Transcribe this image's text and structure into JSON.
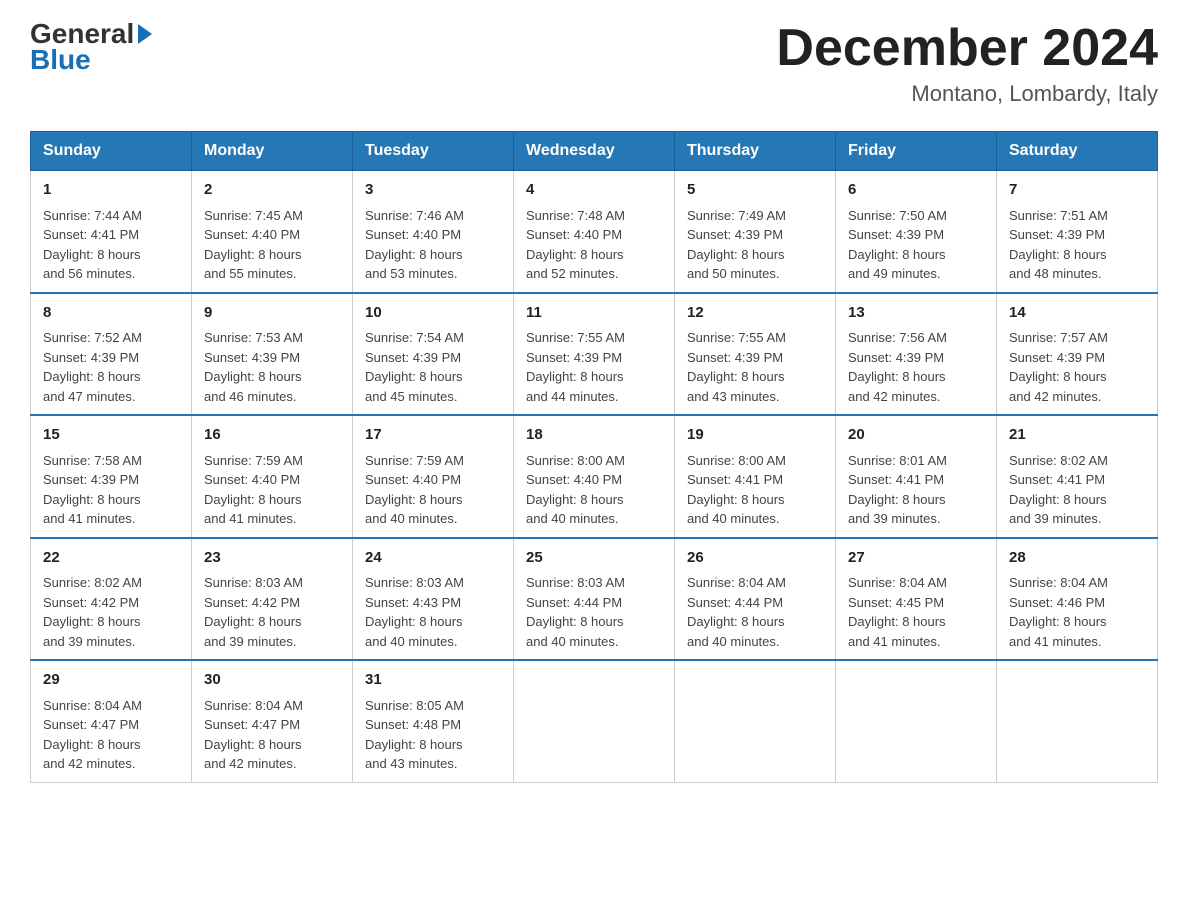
{
  "header": {
    "logo_general": "General",
    "logo_blue": "Blue",
    "month_title": "December 2024",
    "location": "Montano, Lombardy, Italy"
  },
  "weekdays": [
    "Sunday",
    "Monday",
    "Tuesday",
    "Wednesday",
    "Thursday",
    "Friday",
    "Saturday"
  ],
  "weeks": [
    [
      {
        "day": "1",
        "sunrise": "7:44 AM",
        "sunset": "4:41 PM",
        "daylight": "8 hours and 56 minutes."
      },
      {
        "day": "2",
        "sunrise": "7:45 AM",
        "sunset": "4:40 PM",
        "daylight": "8 hours and 55 minutes."
      },
      {
        "day": "3",
        "sunrise": "7:46 AM",
        "sunset": "4:40 PM",
        "daylight": "8 hours and 53 minutes."
      },
      {
        "day": "4",
        "sunrise": "7:48 AM",
        "sunset": "4:40 PM",
        "daylight": "8 hours and 52 minutes."
      },
      {
        "day": "5",
        "sunrise": "7:49 AM",
        "sunset": "4:39 PM",
        "daylight": "8 hours and 50 minutes."
      },
      {
        "day": "6",
        "sunrise": "7:50 AM",
        "sunset": "4:39 PM",
        "daylight": "8 hours and 49 minutes."
      },
      {
        "day": "7",
        "sunrise": "7:51 AM",
        "sunset": "4:39 PM",
        "daylight": "8 hours and 48 minutes."
      }
    ],
    [
      {
        "day": "8",
        "sunrise": "7:52 AM",
        "sunset": "4:39 PM",
        "daylight": "8 hours and 47 minutes."
      },
      {
        "day": "9",
        "sunrise": "7:53 AM",
        "sunset": "4:39 PM",
        "daylight": "8 hours and 46 minutes."
      },
      {
        "day": "10",
        "sunrise": "7:54 AM",
        "sunset": "4:39 PM",
        "daylight": "8 hours and 45 minutes."
      },
      {
        "day": "11",
        "sunrise": "7:55 AM",
        "sunset": "4:39 PM",
        "daylight": "8 hours and 44 minutes."
      },
      {
        "day": "12",
        "sunrise": "7:55 AM",
        "sunset": "4:39 PM",
        "daylight": "8 hours and 43 minutes."
      },
      {
        "day": "13",
        "sunrise": "7:56 AM",
        "sunset": "4:39 PM",
        "daylight": "8 hours and 42 minutes."
      },
      {
        "day": "14",
        "sunrise": "7:57 AM",
        "sunset": "4:39 PM",
        "daylight": "8 hours and 42 minutes."
      }
    ],
    [
      {
        "day": "15",
        "sunrise": "7:58 AM",
        "sunset": "4:39 PM",
        "daylight": "8 hours and 41 minutes."
      },
      {
        "day": "16",
        "sunrise": "7:59 AM",
        "sunset": "4:40 PM",
        "daylight": "8 hours and 41 minutes."
      },
      {
        "day": "17",
        "sunrise": "7:59 AM",
        "sunset": "4:40 PM",
        "daylight": "8 hours and 40 minutes."
      },
      {
        "day": "18",
        "sunrise": "8:00 AM",
        "sunset": "4:40 PM",
        "daylight": "8 hours and 40 minutes."
      },
      {
        "day": "19",
        "sunrise": "8:00 AM",
        "sunset": "4:41 PM",
        "daylight": "8 hours and 40 minutes."
      },
      {
        "day": "20",
        "sunrise": "8:01 AM",
        "sunset": "4:41 PM",
        "daylight": "8 hours and 39 minutes."
      },
      {
        "day": "21",
        "sunrise": "8:02 AM",
        "sunset": "4:41 PM",
        "daylight": "8 hours and 39 minutes."
      }
    ],
    [
      {
        "day": "22",
        "sunrise": "8:02 AM",
        "sunset": "4:42 PM",
        "daylight": "8 hours and 39 minutes."
      },
      {
        "day": "23",
        "sunrise": "8:03 AM",
        "sunset": "4:42 PM",
        "daylight": "8 hours and 39 minutes."
      },
      {
        "day": "24",
        "sunrise": "8:03 AM",
        "sunset": "4:43 PM",
        "daylight": "8 hours and 40 minutes."
      },
      {
        "day": "25",
        "sunrise": "8:03 AM",
        "sunset": "4:44 PM",
        "daylight": "8 hours and 40 minutes."
      },
      {
        "day": "26",
        "sunrise": "8:04 AM",
        "sunset": "4:44 PM",
        "daylight": "8 hours and 40 minutes."
      },
      {
        "day": "27",
        "sunrise": "8:04 AM",
        "sunset": "4:45 PM",
        "daylight": "8 hours and 41 minutes."
      },
      {
        "day": "28",
        "sunrise": "8:04 AM",
        "sunset": "4:46 PM",
        "daylight": "8 hours and 41 minutes."
      }
    ],
    [
      {
        "day": "29",
        "sunrise": "8:04 AM",
        "sunset": "4:47 PM",
        "daylight": "8 hours and 42 minutes."
      },
      {
        "day": "30",
        "sunrise": "8:04 AM",
        "sunset": "4:47 PM",
        "daylight": "8 hours and 42 minutes."
      },
      {
        "day": "31",
        "sunrise": "8:05 AM",
        "sunset": "4:48 PM",
        "daylight": "8 hours and 43 minutes."
      },
      null,
      null,
      null,
      null
    ]
  ],
  "labels": {
    "sunrise": "Sunrise:",
    "sunset": "Sunset:",
    "daylight": "Daylight:"
  }
}
